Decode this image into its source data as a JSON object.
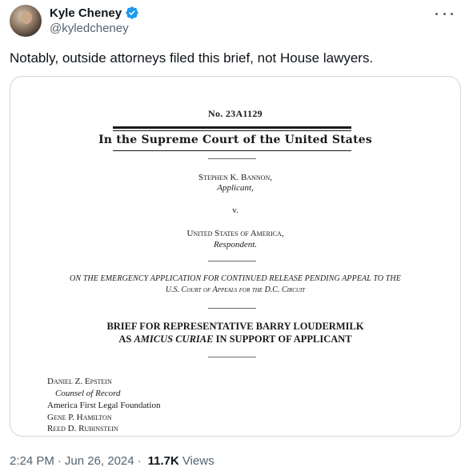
{
  "author": {
    "display_name": "Kyle Cheney",
    "handle": "@kyledcheney",
    "verified_icon": "verified-badge-icon",
    "verified_color": "#1d9bf0"
  },
  "tweet": {
    "text": "Notably, outside attorneys filed this brief, not House lawyers."
  },
  "document": {
    "number": "No. 23A1129",
    "court": "In the Supreme Court of the United States",
    "applicant_name": "Stephen K. Bannon,",
    "applicant_role": "Applicant,",
    "versus": "v.",
    "respondent_name": "United States of America,",
    "respondent_role": "Respondent.",
    "application_line1": "ON THE EMERGENCY APPLICATION FOR CONTINUED RELEASE PENDING APPEAL TO THE",
    "application_line2": "U.S. Court of Appeals for the D.C. Circuit",
    "brief_line1": "BRIEF FOR REPRESENTATIVE BARRY LOUDERMILK",
    "brief_line2_prefix": "AS ",
    "brief_line2_italic": "AMICUS CURIAE",
    "brief_line2_suffix": " IN SUPPORT OF APPLICANT",
    "counsel": [
      "Daniel Z. Epstein",
      "Counsel of Record",
      "America First Legal Foundation",
      "Gene P. Hamilton",
      "Reed D. Rubinstein"
    ]
  },
  "meta": {
    "time": "2:24 PM",
    "separator": "·",
    "date": "Jun 26, 2024",
    "views_count": "11.7K",
    "views_label": "Views"
  }
}
